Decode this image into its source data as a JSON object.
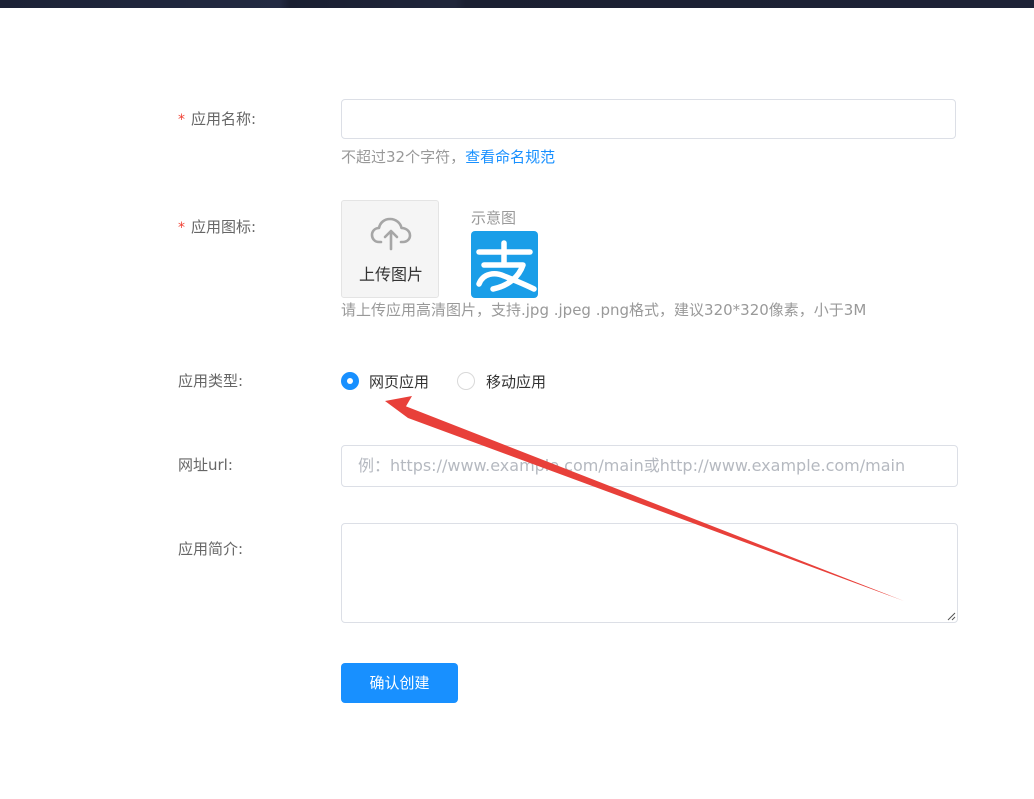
{
  "form": {
    "name": {
      "label": "应用名称:",
      "required_mark": "*",
      "value": "",
      "hint": "不超过32个字符，",
      "hint_link": "查看命名规范"
    },
    "icon": {
      "label": "应用图标:",
      "required_mark": "*",
      "upload_label": "上传图片",
      "sample_label": "示意图",
      "sample_glyph": "支",
      "hint": "请上传应用高清图片，支持.jpg .jpeg .png格式，建议320*320像素，小于3M"
    },
    "type": {
      "label": "应用类型:",
      "options": [
        {
          "label": "网页应用",
          "selected": true
        },
        {
          "label": "移动应用",
          "selected": false
        }
      ]
    },
    "url": {
      "label": "网址url:",
      "placeholder": "例：https://www.example.com/main或http://www.example.com/main",
      "value": ""
    },
    "intro": {
      "label": "应用简介:",
      "value": ""
    },
    "submit_label": "确认创建"
  },
  "colors": {
    "primary": "#1890ff",
    "required": "#f04134",
    "alipay_blue": "#1a9ee8",
    "annotation_arrow": "#e8403a"
  },
  "icons": {
    "upload": "cloud-upload-icon",
    "sample": "alipay-logo"
  }
}
